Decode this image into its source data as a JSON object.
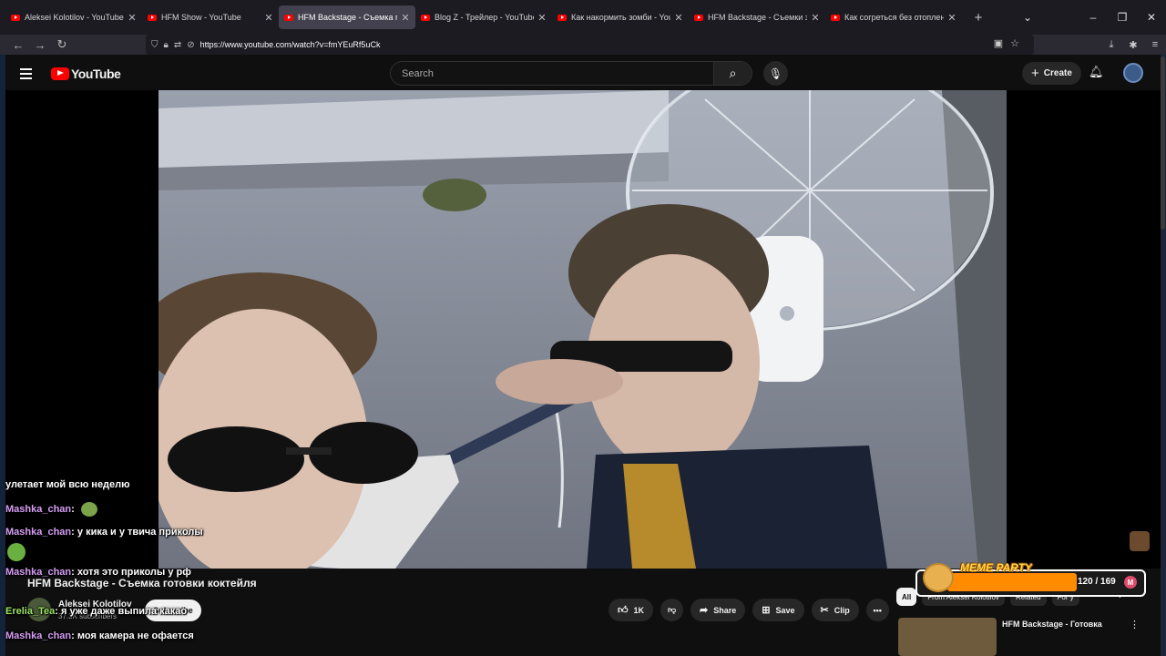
{
  "browser": {
    "tabs": [
      {
        "title": "Aleksei Kolotilov - YouTube",
        "active": false
      },
      {
        "title": "HFM Show - YouTube",
        "active": false
      },
      {
        "title": "HFM Backstage - Съемка готовки",
        "active": true
      },
      {
        "title": "Blog Z - Трейлер - YouTube",
        "active": false
      },
      {
        "title": "Как накормить зомби - YouTube",
        "active": false
      },
      {
        "title": "HFM Backstage - Съемки зомби",
        "active": false
      },
      {
        "title": "Как согреться без отопления -",
        "active": false
      }
    ],
    "new_tab": "+",
    "url": "https://www.youtube.com/watch?v=fmYEuRf5uCk"
  },
  "youtube": {
    "logo_text": "YouTube",
    "search_placeholder": "Search",
    "create_label": "Create"
  },
  "video": {
    "title": "HFM Backstage - Съемка готовки коктейля",
    "channel_name": "Aleksei Kolotilov",
    "subscribers": "37.3K subscribers",
    "subscribe_label": "Subscribe",
    "likes": "1K",
    "share_label": "Share",
    "save_label": "Save",
    "clip_label": "Clip"
  },
  "sidebar": {
    "chips": [
      "All",
      "From Aleksei Kolotilov",
      "Related",
      "For y"
    ],
    "recommendation_title": "HFM Backstage - Готовка"
  },
  "chat": {
    "lines": [
      {
        "user": "",
        "text": "улетает мой всю неделю"
      },
      {
        "user": "Mashka_chan",
        "text": ""
      },
      {
        "user": "Mashka_chan",
        "text": "у кика и у твича приколы"
      },
      {
        "user": "Mashka_chan",
        "text": "хотя это приколы у рф"
      },
      {
        "user": "Erelia_Tea",
        "text": "я уже даже выпила какао"
      },
      {
        "user": "Mashka_chan",
        "text": "моя камера не офается"
      }
    ]
  },
  "overlay": {
    "meme_title": "MEME PARTY",
    "meme_count": "120 / 169",
    "meme_progress": 0.71
  },
  "colors": {
    "youtube_red": "#ff0000",
    "chat_name_purple": "#d59df3",
    "chat_name_green": "#9be564",
    "meme_bar": "#ff8c00"
  }
}
